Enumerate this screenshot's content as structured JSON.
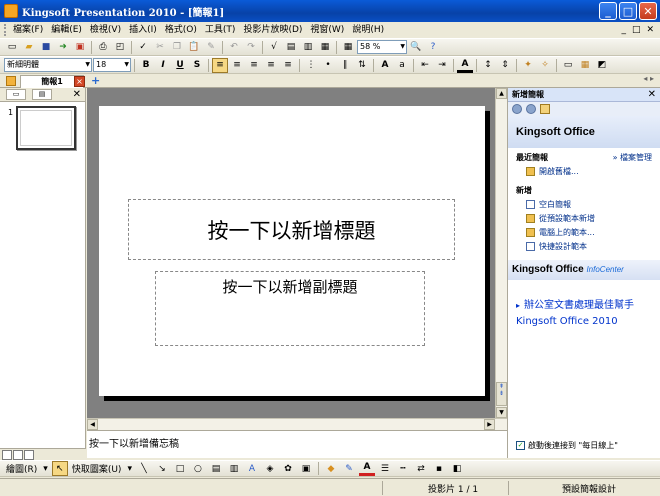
{
  "window": {
    "title": "Kingsoft Presentation 2010 - [簡報1]",
    "minimize": "_",
    "maximize": "□",
    "close": "✕"
  },
  "menu": {
    "items": [
      "檔案(F)",
      "編輯(E)",
      "檢視(V)",
      "插入(I)",
      "格式(O)",
      "工具(T)",
      "投影片放映(D)",
      "視窗(W)",
      "說明(H)"
    ],
    "mdi_controls": [
      "_",
      "□",
      "✕"
    ]
  },
  "toolbar": {
    "zoom": "58 %",
    "font_name": "新細明體",
    "font_size": "18",
    "format_buttons": [
      "B",
      "I",
      "U",
      "S"
    ]
  },
  "doc_tab": {
    "label": "簡報1",
    "close": "×",
    "add": "+"
  },
  "slide_panel": {
    "close": "✕",
    "slide_number": "1"
  },
  "slide": {
    "title_placeholder": "按一下以新增標題",
    "subtitle_placeholder": "按一下以新增副標題"
  },
  "notes": {
    "placeholder": "按一下以新增備忘稿"
  },
  "task_pane": {
    "title": "新增簡報",
    "close": "✕",
    "brand": "Kingsoft Office",
    "recent_heading": "最近簡報",
    "manage_link": "» 檔案管理",
    "open_link": "開啟舊檔...",
    "new_heading": "新增",
    "new_links": [
      "空白簡報",
      "從預設範本新增",
      "電腦上的範本...",
      "快捷設計範本"
    ],
    "infocenter_brand": "Kingsoft Office",
    "infocenter_tag": "InfoCenter",
    "news": "辦公室文書處理最佳幫手Kingsoft Office 2010",
    "startup_label": "啟動後連接到 \"每日線上\"",
    "startup_checked": true
  },
  "draw_toolbar": {
    "draw_label": "繪圖(R)",
    "autoshapes_label": "快取圖案(U)"
  },
  "status": {
    "slide_count": "投影片 1 / 1",
    "design": "預設簡報設計"
  }
}
